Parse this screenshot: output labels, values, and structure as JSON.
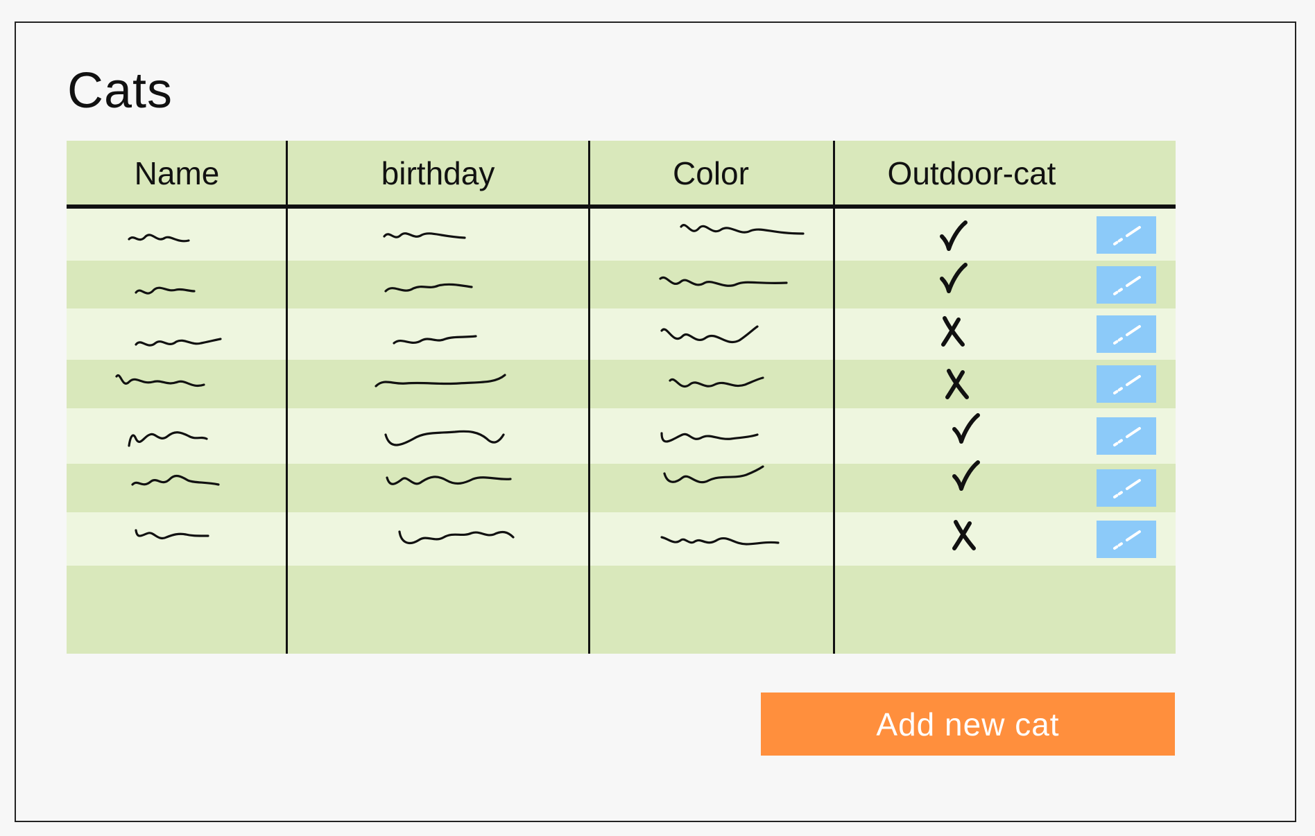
{
  "page": {
    "title": "Cats"
  },
  "table": {
    "columns": [
      "Name",
      "birthday",
      "Color",
      "Outdoor-cat"
    ],
    "rows": [
      {
        "outdoor": "yes"
      },
      {
        "outdoor": "yes"
      },
      {
        "outdoor": "no"
      },
      {
        "outdoor": "no"
      },
      {
        "outdoor": "yes"
      },
      {
        "outdoor": "yes"
      },
      {
        "outdoor": "no"
      }
    ],
    "row_colors": {
      "light": "#eef6df",
      "dark": "#d9e8bb"
    },
    "edit_icon": "pencil-icon"
  },
  "actions": {
    "add_label": "Add new cat",
    "add_color": "#ff8f3d"
  }
}
